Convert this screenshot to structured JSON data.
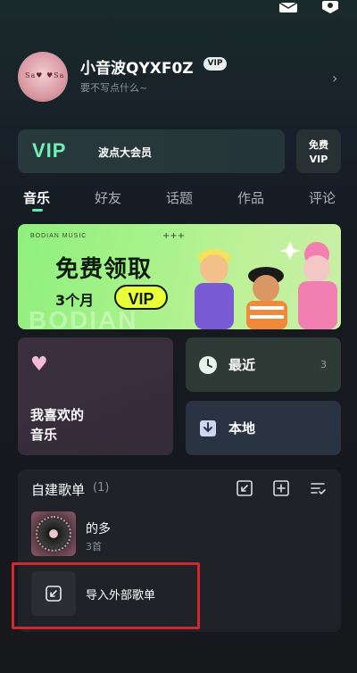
{
  "profile": {
    "username": "小音波QYXF0Z",
    "vip_badge": "VIP",
    "signature": "要不写点什么~",
    "avatar_text": "♥",
    "chevron": "›"
  },
  "vip_banner": {
    "vip_word": "VIP",
    "subtitle": "波点大会员",
    "free_vip_line1": "免费",
    "free_vip_line2": "VIP"
  },
  "tabs": [
    {
      "label": "音乐",
      "active": true
    },
    {
      "label": "好友",
      "active": false
    },
    {
      "label": "话题",
      "active": false
    },
    {
      "label": "作品",
      "active": false
    },
    {
      "label": "评论",
      "active": false
    }
  ],
  "promo": {
    "brand": "BODIAN MUSIC",
    "plus": "+++",
    "title": "免费领取",
    "months": "3个月",
    "vip": "VIP",
    "watermark": "BODIAN"
  },
  "cards": {
    "favorite": {
      "line1": "我喜欢的",
      "line2": "音乐"
    },
    "recent": {
      "label": "最近",
      "count": "3"
    },
    "local": {
      "label": "本地"
    }
  },
  "playlists": {
    "title": "自建歌单",
    "count": "(1)",
    "items": [
      {
        "name": "的多",
        "subtitle": "3首"
      }
    ],
    "import_label": "导入外部歌单"
  },
  "colors": {
    "accent": "#5fe8b0",
    "highlight_border": "#d3262f",
    "promo_bg": "#a7f28a"
  }
}
